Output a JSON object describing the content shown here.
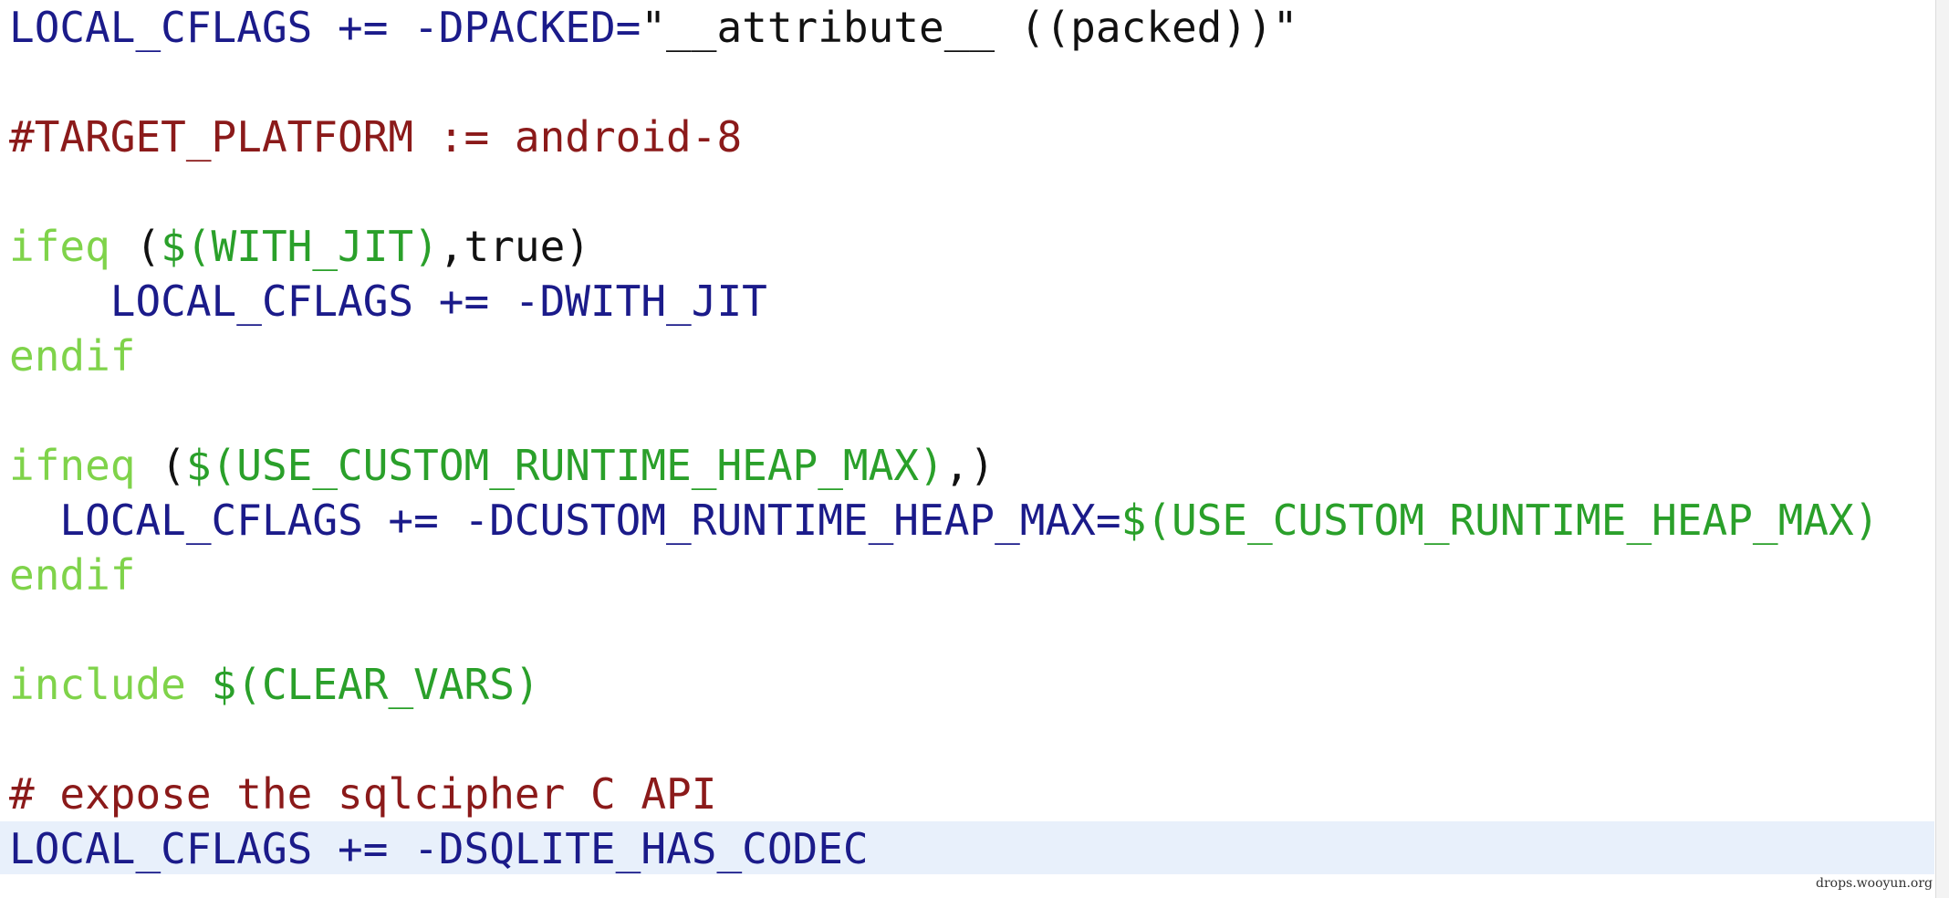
{
  "lines": [
    [
      {
        "t": "LOCAL_CFLAGS += -DPACKED=",
        "c": "kw"
      },
      {
        "t": "\"__attribute__ ((packed))\"",
        "c": "txt"
      }
    ],
    [],
    [
      {
        "t": "#TARGET_PLATFORM := android-8",
        "c": "com"
      }
    ],
    [],
    [
      {
        "t": "ifeq",
        "c": "cond"
      },
      {
        "t": " (",
        "c": "txt"
      },
      {
        "t": "$(WITH_JIT)",
        "c": "func"
      },
      {
        "t": ",true)",
        "c": "txt"
      }
    ],
    [
      {
        "t": "    LOCAL_CFLAGS += -DWITH_JIT",
        "c": "kw"
      }
    ],
    [
      {
        "t": "endif",
        "c": "cond"
      }
    ],
    [],
    [
      {
        "t": "ifneq",
        "c": "cond"
      },
      {
        "t": " (",
        "c": "txt"
      },
      {
        "t": "$(USE_CUSTOM_RUNTIME_HEAP_MAX)",
        "c": "func"
      },
      {
        "t": ",)",
        "c": "txt"
      }
    ],
    [
      {
        "t": "  LOCAL_CFLAGS += -DCUSTOM_RUNTIME_HEAP_MAX=",
        "c": "kw"
      },
      {
        "t": "$(USE_CUSTOM_RUNTIME_HEAP_MAX)",
        "c": "func"
      }
    ],
    [
      {
        "t": "endif",
        "c": "cond"
      }
    ],
    [],
    [
      {
        "t": "include",
        "c": "cond"
      },
      {
        "t": " ",
        "c": "txt"
      },
      {
        "t": "$(CLEAR_VARS)",
        "c": "func"
      }
    ],
    [],
    [
      {
        "t": "# expose the sqlcipher C API",
        "c": "com"
      }
    ],
    [
      {
        "t": "LOCAL_CFLAGS += -DSQLITE_HAS_CODEC",
        "c": "kw"
      }
    ]
  ],
  "highlighted_line": 15,
  "watermark": "drops.wooyun.org",
  "colors": {
    "keyword": "#1b1b8a",
    "comment": "#8b1a1a",
    "conditional": "#7fd34a",
    "function": "#2aa02a",
    "current_line": "#e8f0fb"
  }
}
